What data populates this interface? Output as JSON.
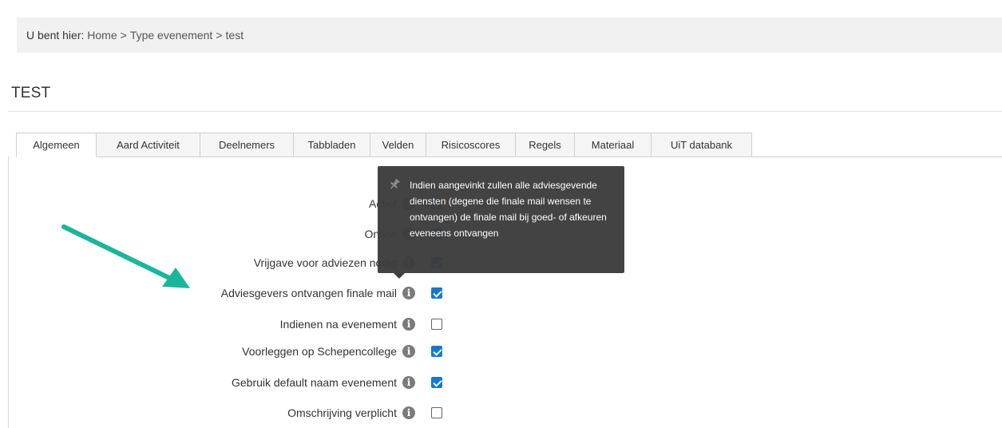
{
  "breadcrumb": {
    "prefix": "U bent hier:",
    "items": [
      "Home",
      "Type evenement",
      "test"
    ],
    "separator": ">"
  },
  "page": {
    "title": "TEST"
  },
  "tabs": [
    {
      "label": "Algemeen",
      "active": true
    },
    {
      "label": "Aard Activiteit",
      "active": false
    },
    {
      "label": "Deelnemers",
      "active": false
    },
    {
      "label": "Tabbladen",
      "active": false
    },
    {
      "label": "Velden",
      "active": false
    },
    {
      "label": "Risicoscores",
      "active": false
    },
    {
      "label": "Regels",
      "active": false
    },
    {
      "label": "Materiaal",
      "active": false
    },
    {
      "label": "UiT databank",
      "active": false
    }
  ],
  "settings": [
    {
      "label": "Actief",
      "checked": true
    },
    {
      "label": "Online",
      "checked": true
    },
    {
      "label": "Vrijgave voor adviezen nodig",
      "checked": true
    },
    {
      "label": "Adviesgevers ontvangen finale mail",
      "checked": true
    },
    {
      "label": "Indienen na evenement",
      "checked": false
    },
    {
      "label": "Voorleggen op Schepencollege",
      "checked": true
    },
    {
      "label": "Gebruik default naam evenement",
      "checked": true
    },
    {
      "label": "Omschrijving verplicht",
      "checked": false
    }
  ],
  "tooltip": {
    "text": "Indien aangevinkt zullen alle adviesgevende diensten (degene die finale mail wensen te ontvangen) de finale mail bij goed- of afkeuren eveneens ontvangen"
  },
  "info_icon_glyph": "i",
  "colors": {
    "checkbox_checked": "#1479d1",
    "tooltip_bg": "#3d3d3d",
    "annotation_arrow": "#1bb59a",
    "breadcrumb_bg": "#f1f1f1"
  }
}
